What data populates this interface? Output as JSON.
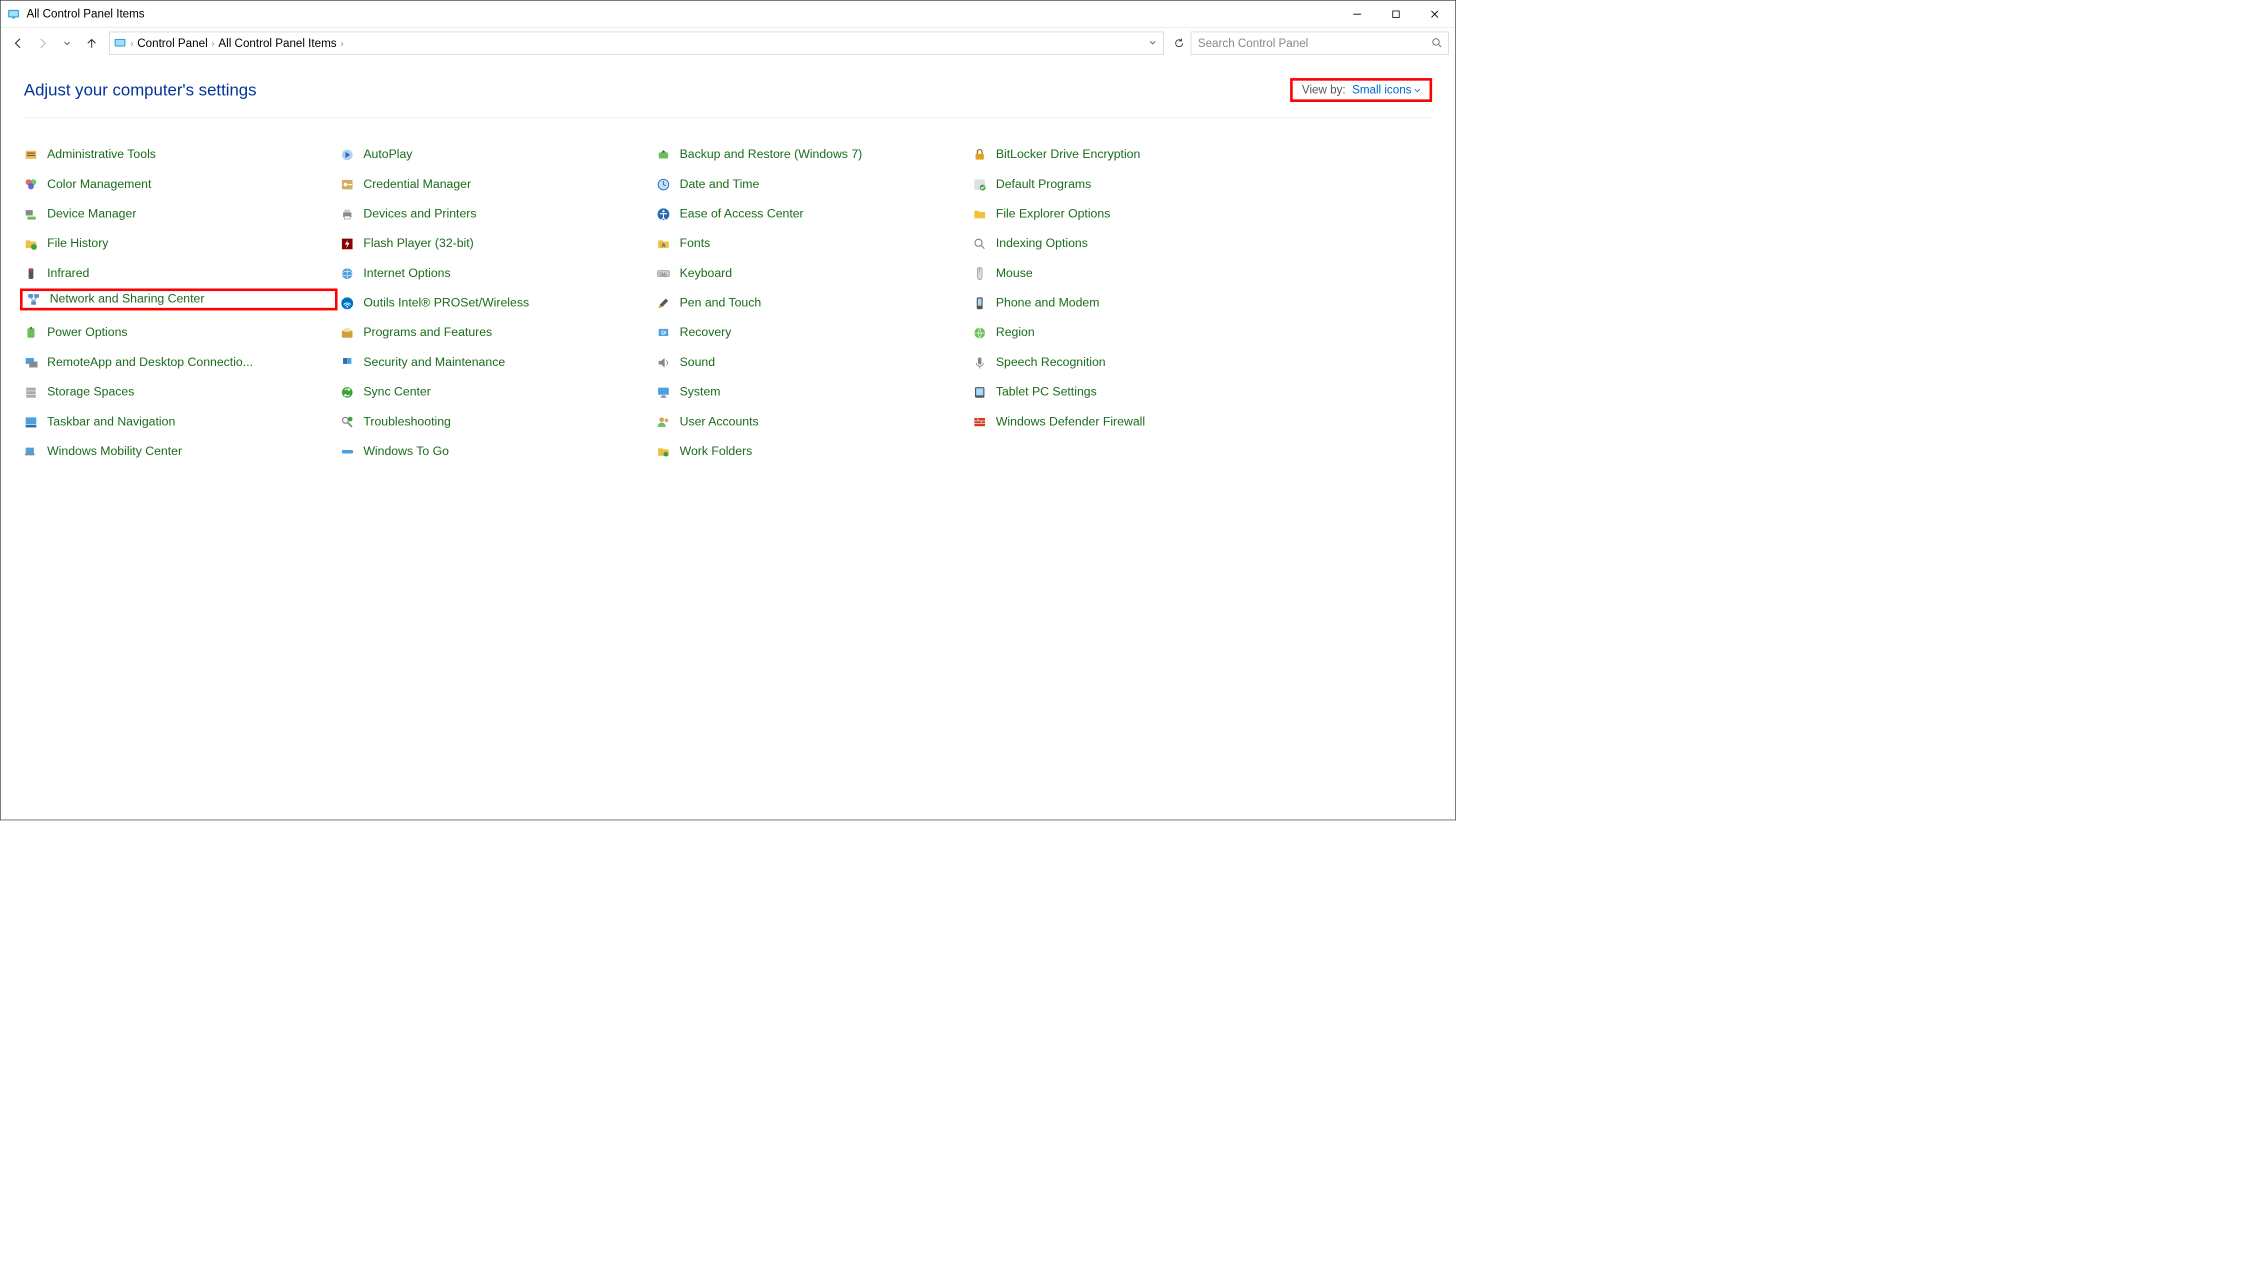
{
  "window_title": "All Control Panel Items",
  "breadcrumbs": [
    "Control Panel",
    "All Control Panel Items"
  ],
  "search_placeholder": "Search Control Panel",
  "page_heading": "Adjust your computer's settings",
  "viewby_label": "View by:",
  "viewby_value": "Small icons",
  "items": [
    {
      "label": "Administrative Tools",
      "icon": "admin-tools"
    },
    {
      "label": "AutoPlay",
      "icon": "autoplay"
    },
    {
      "label": "Backup and Restore (Windows 7)",
      "icon": "backup"
    },
    {
      "label": "BitLocker Drive Encryption",
      "icon": "bitlocker"
    },
    {
      "label": "Color Management",
      "icon": "color"
    },
    {
      "label": "Credential Manager",
      "icon": "credential"
    },
    {
      "label": "Date and Time",
      "icon": "datetime"
    },
    {
      "label": "Default Programs",
      "icon": "defaults"
    },
    {
      "label": "Device Manager",
      "icon": "device-mgr"
    },
    {
      "label": "Devices and Printers",
      "icon": "printers"
    },
    {
      "label": "Ease of Access Center",
      "icon": "ease"
    },
    {
      "label": "File Explorer Options",
      "icon": "folder-opts"
    },
    {
      "label": "File History",
      "icon": "file-history"
    },
    {
      "label": "Flash Player (32-bit)",
      "icon": "flash"
    },
    {
      "label": "Fonts",
      "icon": "fonts"
    },
    {
      "label": "Indexing Options",
      "icon": "indexing"
    },
    {
      "label": "Infrared",
      "icon": "infrared"
    },
    {
      "label": "Internet Options",
      "icon": "internet"
    },
    {
      "label": "Keyboard",
      "icon": "keyboard"
    },
    {
      "label": "Mouse",
      "icon": "mouse"
    },
    {
      "label": "Network and Sharing Center",
      "icon": "network",
      "highlight": true
    },
    {
      "label": "Outils Intel® PROSet/Wireless",
      "icon": "intel-wireless"
    },
    {
      "label": "Pen and Touch",
      "icon": "pen"
    },
    {
      "label": "Phone and Modem",
      "icon": "phone"
    },
    {
      "label": "Power Options",
      "icon": "power"
    },
    {
      "label": "Programs and Features",
      "icon": "programs"
    },
    {
      "label": "Recovery",
      "icon": "recovery"
    },
    {
      "label": "Region",
      "icon": "region"
    },
    {
      "label": "RemoteApp and Desktop Connectio...",
      "icon": "remoteapp"
    },
    {
      "label": "Security and Maintenance",
      "icon": "security"
    },
    {
      "label": "Sound",
      "icon": "sound"
    },
    {
      "label": "Speech Recognition",
      "icon": "speech"
    },
    {
      "label": "Storage Spaces",
      "icon": "storage"
    },
    {
      "label": "Sync Center",
      "icon": "sync"
    },
    {
      "label": "System",
      "icon": "system"
    },
    {
      "label": "Tablet PC Settings",
      "icon": "tablet"
    },
    {
      "label": "Taskbar and Navigation",
      "icon": "taskbar"
    },
    {
      "label": "Troubleshooting",
      "icon": "troubleshoot"
    },
    {
      "label": "User Accounts",
      "icon": "users"
    },
    {
      "label": "Windows Defender Firewall",
      "icon": "firewall"
    },
    {
      "label": "Windows Mobility Center",
      "icon": "mobility"
    },
    {
      "label": "Windows To Go",
      "icon": "windows-to-go"
    },
    {
      "label": "Work Folders",
      "icon": "work-folders"
    }
  ]
}
